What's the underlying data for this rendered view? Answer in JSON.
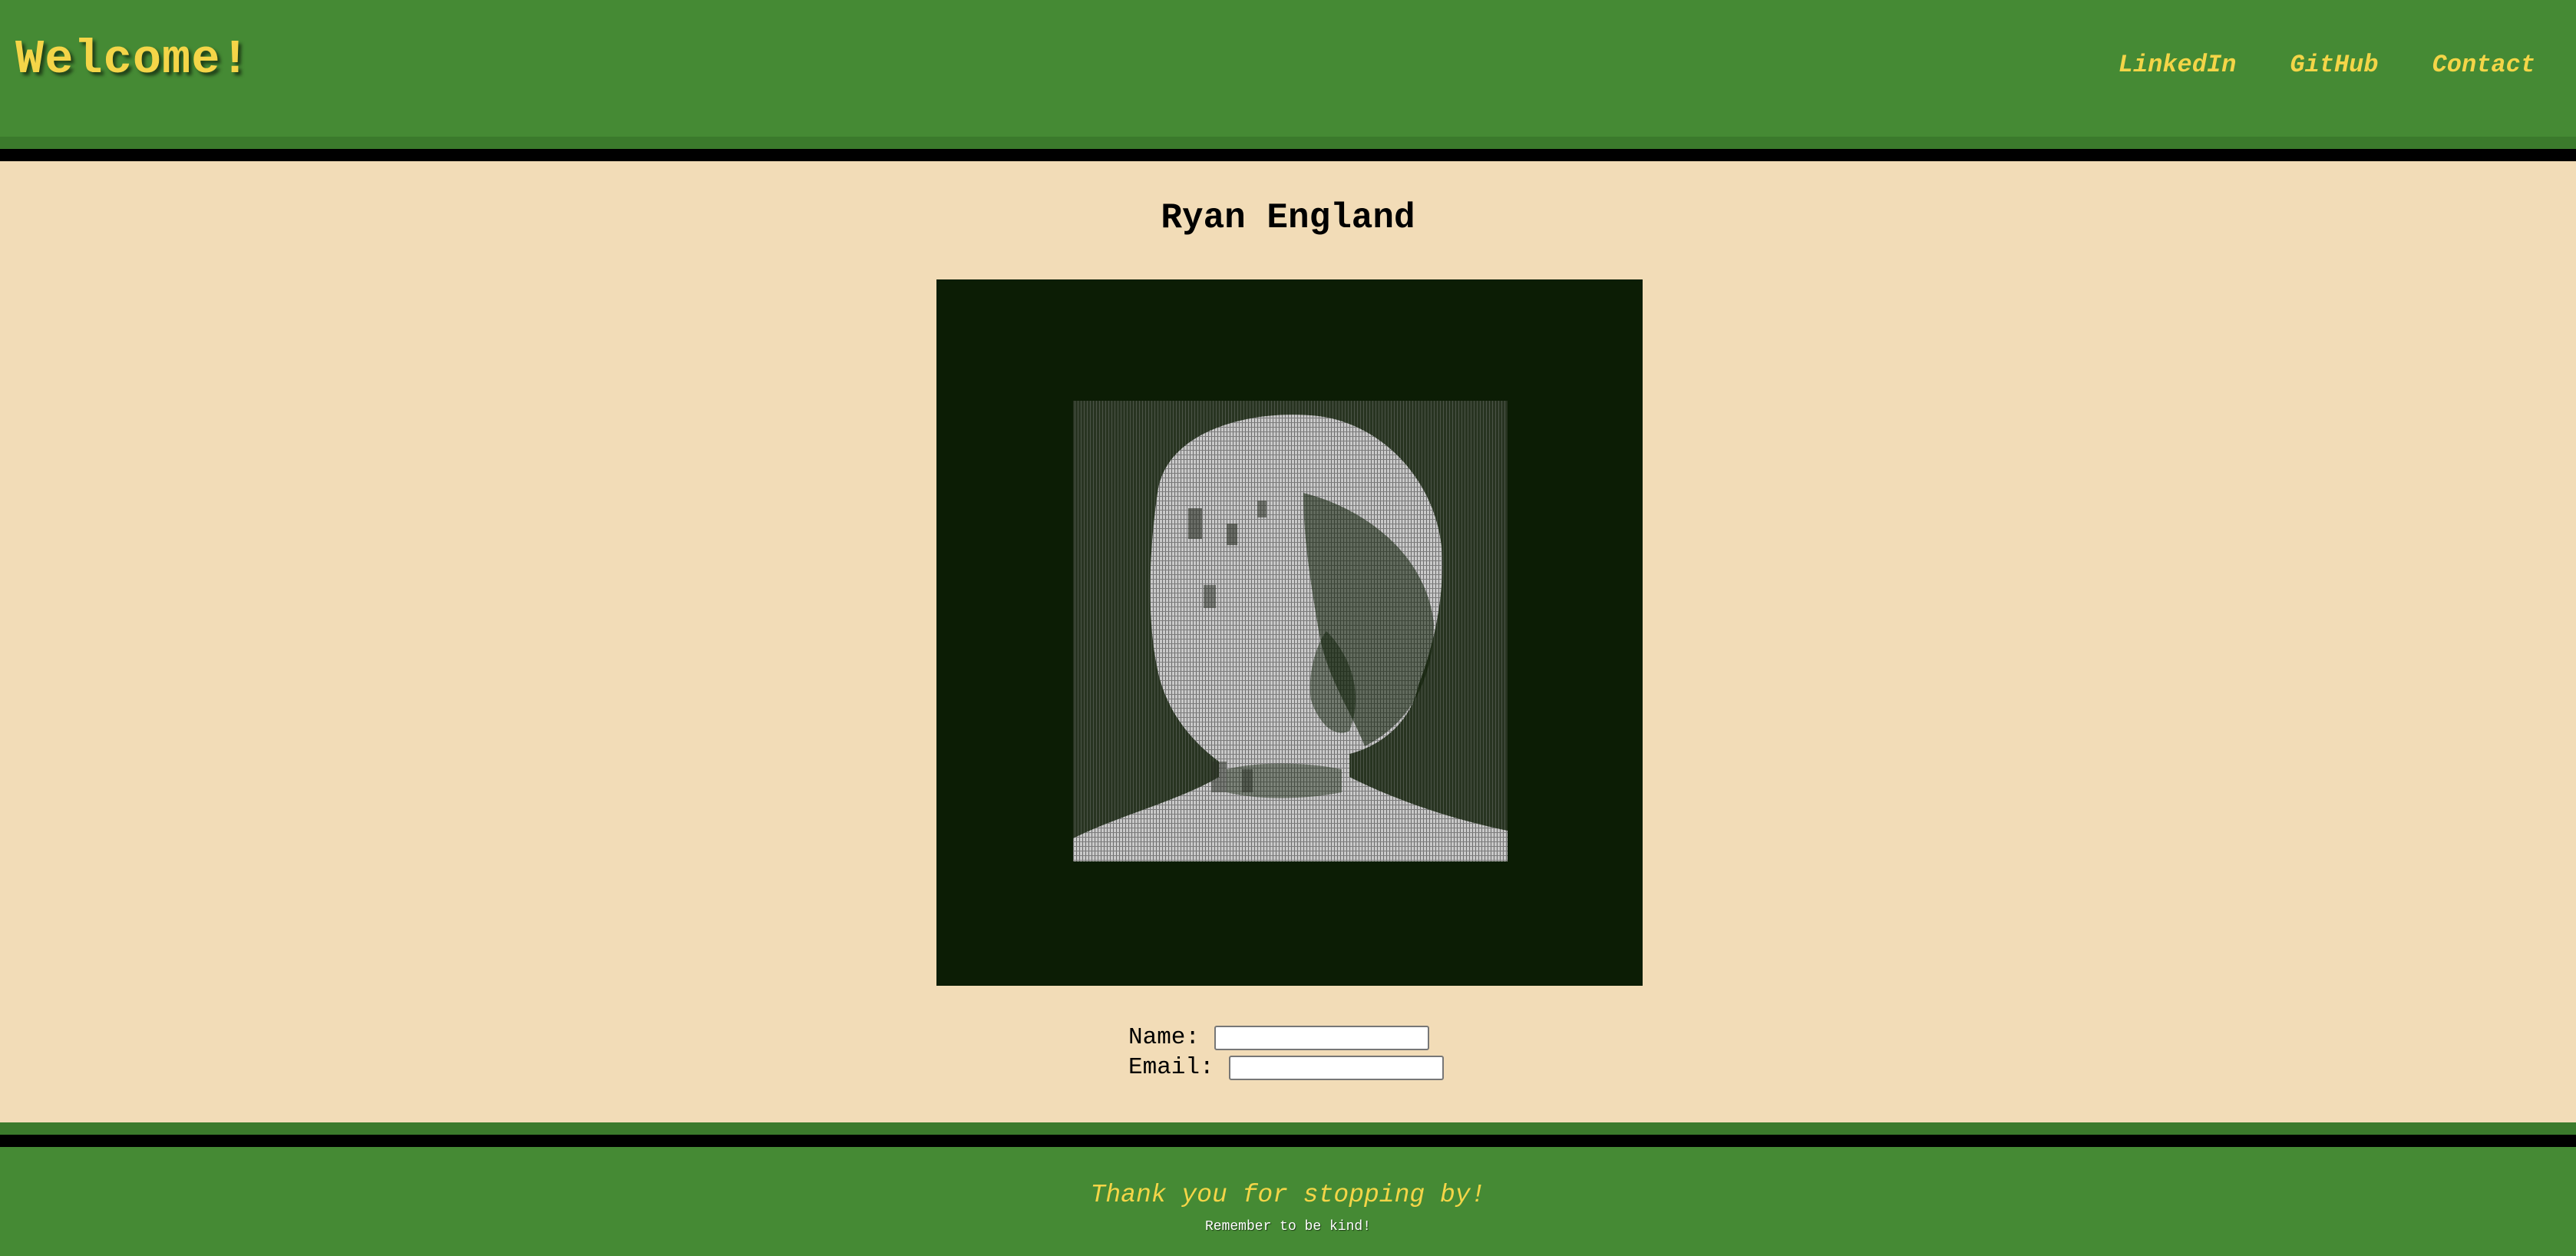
{
  "header": {
    "title": "Welcome!",
    "nav": [
      {
        "label": "LinkedIn"
      },
      {
        "label": "GitHub"
      },
      {
        "label": "Contact"
      }
    ]
  },
  "main": {
    "name": "Ryan England",
    "portrait": {
      "icon": "ascii-portrait-image",
      "background": "#0c1d05"
    },
    "form": {
      "name_label": "Name:",
      "name_value": "",
      "email_label": "Email:",
      "email_value": ""
    }
  },
  "footer": {
    "thanks": "Thank you for stopping by!",
    "note": "Remember to be kind!"
  },
  "colors": {
    "header_green": "#458a34",
    "accent_yellow": "#f4d548",
    "page_background": "#f2dcb7"
  }
}
